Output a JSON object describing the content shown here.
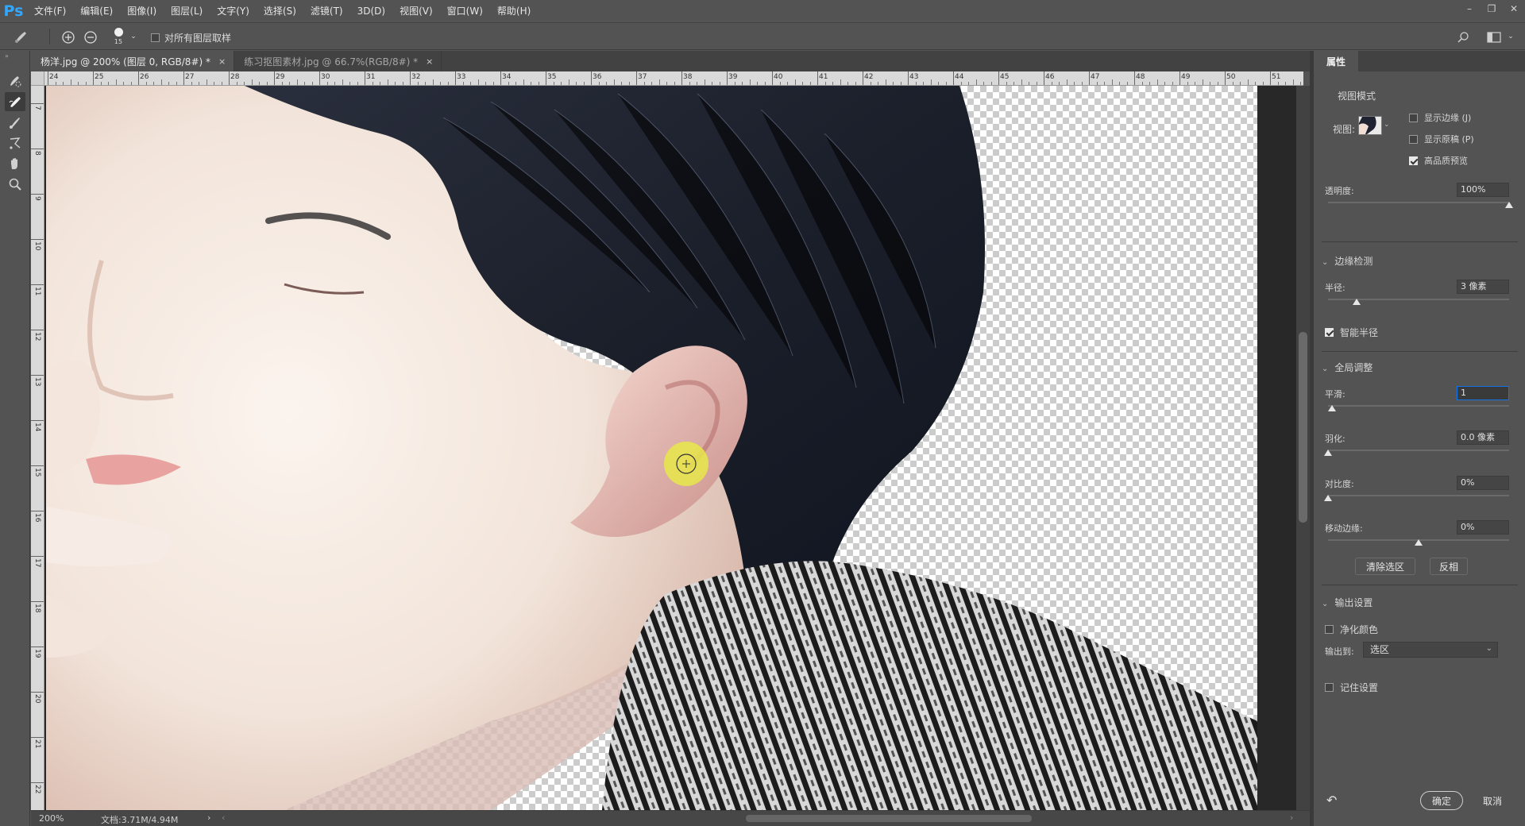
{
  "app": {
    "logo": "Ps",
    "menu": [
      "文件(F)",
      "编辑(E)",
      "图像(I)",
      "图层(L)",
      "文字(Y)",
      "选择(S)",
      "滤镜(T)",
      "3D(D)",
      "视图(V)",
      "窗口(W)",
      "帮助(H)"
    ]
  },
  "options_bar": {
    "brush_size": "15",
    "sample_all_layers_label": "对所有图层取样",
    "sample_all_layers_checked": false
  },
  "tabs": [
    {
      "label": "杨洋.jpg @ 200% (图层 0, RGB/8#) *",
      "active": true
    },
    {
      "label": "练习抠图素材.jpg @ 66.7%(RGB/8#) *",
      "active": false
    }
  ],
  "ruler": {
    "h_labels": [
      "24",
      "25",
      "26",
      "27",
      "28",
      "29",
      "30",
      "31",
      "32",
      "33",
      "34",
      "35",
      "36",
      "37",
      "38",
      "39",
      "40",
      "41",
      "42",
      "43",
      "44",
      "45",
      "46",
      "47",
      "48",
      "49",
      "50",
      "51"
    ],
    "v_labels": [
      "7",
      "8",
      "9",
      "10",
      "11",
      "12",
      "13",
      "14",
      "15",
      "16",
      "17",
      "18",
      "19",
      "20",
      "21",
      "22"
    ]
  },
  "status": {
    "zoom": "200%",
    "doc": "文档:3.71M/4.94M"
  },
  "panel": {
    "tab": "属性",
    "view_mode": {
      "title": "视图模式",
      "view_label": "视图:",
      "show_edge": {
        "label": "显示边缘 (J)",
        "checked": false
      },
      "show_original": {
        "label": "显示原稿 (P)",
        "checked": false
      },
      "hq_preview": {
        "label": "高品质预览",
        "checked": true
      }
    },
    "opacity": {
      "label": "透明度:",
      "value": "100%",
      "fraction": 1.0
    },
    "edge_detection": {
      "title": "边缘检测",
      "radius": {
        "label": "半径:",
        "value": "3 像素",
        "fraction": 0.16
      },
      "smart_radius": {
        "label": "智能半径",
        "checked": true
      }
    },
    "global_refine": {
      "title": "全局调整",
      "smooth": {
        "label": "平滑:",
        "value": "1",
        "fraction": 0.02
      },
      "feather": {
        "label": "羽化:",
        "value": "0.0 像素",
        "fraction": 0.0
      },
      "contrast": {
        "label": "对比度:",
        "value": "0%",
        "fraction": 0.0
      },
      "shift_edge": {
        "label": "移动边缘:",
        "value": "0%",
        "fraction": 0.5
      },
      "clear_selection": "清除选区",
      "invert": "反相"
    },
    "output": {
      "title": "输出设置",
      "decontaminate": {
        "label": "净化颜色",
        "checked": false
      },
      "output_to_label": "输出到:",
      "output_to_value": "选区",
      "remember": {
        "label": "记住设置",
        "checked": false
      }
    },
    "ok": "确定",
    "cancel": "取消"
  },
  "colors": {
    "accent_blue": "#1473e6",
    "cursor_highlight": "#e8e84a"
  }
}
